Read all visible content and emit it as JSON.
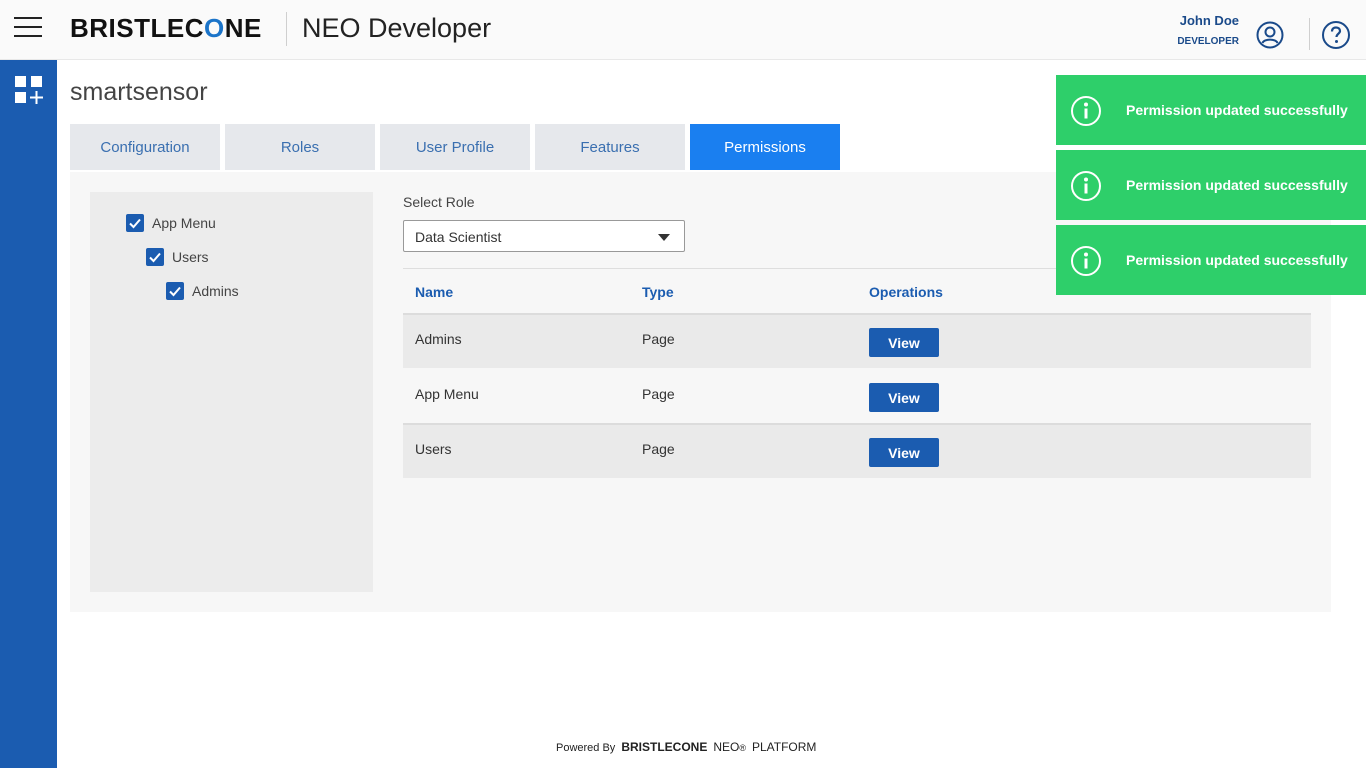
{
  "header": {
    "logo_text": "BRISTLEC",
    "logo_o": "O",
    "logo_end": "NE",
    "app_title": "NEO Developer",
    "user_name": "John Doe",
    "user_role": "DEVELOPER"
  },
  "page": {
    "title": "smartsensor"
  },
  "tabs": [
    {
      "label": "Configuration"
    },
    {
      "label": "Roles"
    },
    {
      "label": "User Profile"
    },
    {
      "label": "Features"
    },
    {
      "label": "Permissions",
      "active": true
    }
  ],
  "tree": {
    "items": [
      {
        "label": "App Menu",
        "checked": true
      },
      {
        "label": "Users",
        "checked": true
      },
      {
        "label": "Admins",
        "checked": true
      }
    ]
  },
  "role_select": {
    "label": "Select Role",
    "value": "Data Scientist"
  },
  "table": {
    "headers": [
      "Name",
      "Type",
      "Operations"
    ],
    "rows": [
      {
        "name": "Admins",
        "type": "Page",
        "action": "View"
      },
      {
        "name": "App Menu",
        "type": "Page",
        "action": "View"
      },
      {
        "name": "Users",
        "type": "Page",
        "action": "View"
      }
    ]
  },
  "toasts": [
    {
      "text": "Permission updated successfully"
    },
    {
      "text": "Permission updated successfully"
    },
    {
      "text": "Permission updated successfully"
    }
  ],
  "footer": {
    "powered_by": "Powered By",
    "brand": "BRISTLECONE",
    "neo": "NEO",
    "registered": "®",
    "platform": "PLATFORM"
  },
  "colors": {
    "accent": "#1b5cb0",
    "active_tab": "#1a7ff0",
    "toast": "#2ecf6a"
  }
}
